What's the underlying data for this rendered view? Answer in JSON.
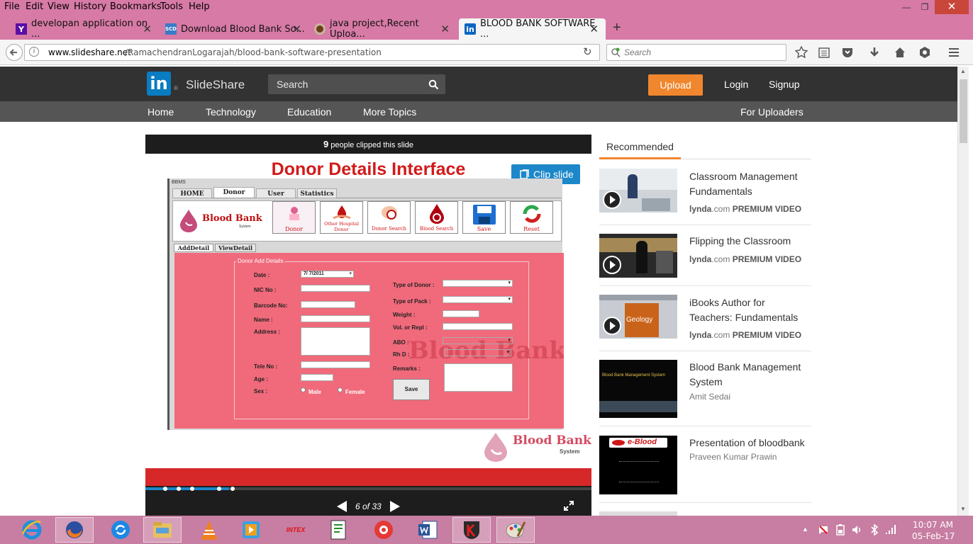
{
  "menu": [
    "File",
    "Edit",
    "View",
    "History",
    "Bookmarks",
    "Tools",
    "Help"
  ],
  "tabs": [
    {
      "title": "developan application on ...",
      "icon": "yahoo-icon"
    },
    {
      "title": "Download Blood Bank So...",
      "icon": "scd-icon"
    },
    {
      "title": "java project,Recent Uploa...",
      "icon": "java-icon"
    },
    {
      "title": "BLOOD BANK SOFTWARE ...",
      "icon": "linkedin-icon"
    }
  ],
  "url": {
    "host": "www.slideshare.net",
    "path": "/RamachendranLogarajah/blood-bank-software-presentation"
  },
  "browser_search_placeholder": "Search",
  "slideshare": {
    "brand": "SlideShare",
    "search_placeholder": "Search",
    "upload": "Upload",
    "login": "Login",
    "signup": "Signup",
    "nav": [
      "Home",
      "Technology",
      "Education",
      "More Topics"
    ],
    "for_uploaders": "For Uploaders"
  },
  "slide": {
    "clip_count": "9",
    "clip_text": "people clipped this slide",
    "clip_button": "Clip slide",
    "title": "Donor Details Interface",
    "counter": "6 of 33",
    "app": {
      "window_label": "BBMS",
      "tabs": [
        "HOME",
        "Donor",
        "User",
        "Statistics"
      ],
      "logo_text": "Blood Bank",
      "logo_sub": "System",
      "toolbar": [
        "Donor",
        "Other Hospital Donor",
        "Donor Search",
        "Blood Search",
        "Save",
        "Reset"
      ],
      "subtabs": [
        "AddDetail",
        "ViewDetail"
      ],
      "group_title": "Donor Add Details",
      "labels_left": [
        "Date :",
        "NIC No :",
        "Barcode No:",
        "Name :",
        "Address :",
        "Tele No :",
        "Age :",
        "Sex :"
      ],
      "date_value": "7/ 7/2011",
      "labels_right": [
        "Type of Donor :",
        "Type of Pack :",
        "Weight :",
        "Vol. or Repl :",
        "ABO :",
        "Rh D :",
        "Remarks :"
      ],
      "sex_options": [
        "Male",
        "Female"
      ],
      "save": "Save",
      "watermark": "Blood Bank"
    },
    "footer_logo": "Blood Bank",
    "footer_sub": "System"
  },
  "recommended": {
    "heading": "Recommended",
    "items": [
      {
        "title": "Classroom Management Fundamentals",
        "source": "lynda",
        "source_suffix": ".com",
        "badge": "PREMIUM VIDEO"
      },
      {
        "title": "Flipping the Classroom",
        "source": "lynda",
        "source_suffix": ".com",
        "badge": "PREMIUM VIDEO"
      },
      {
        "title": "iBooks Author for Teachers: Fundamentals",
        "source": "lynda",
        "source_suffix": ".com",
        "badge": "PREMIUM VIDEO",
        "thumb_text": "Geology"
      },
      {
        "title": "Blood Bank Management System",
        "author": "Amit Sedai",
        "thumb_text": "Blood Bank Management System"
      },
      {
        "title": "Presentation of bloodbank",
        "author": "Praveen Kumar Prawin",
        "thumb_text": "e-Blood"
      }
    ]
  },
  "taskbar": {
    "time": "10:07 AM",
    "date": "05-Feb-17",
    "apps": [
      "ie-icon",
      "firefox-icon",
      "sync-icon",
      "file-explorer-icon",
      "vlc-icon",
      "media-player-icon",
      "intex-icon",
      "notepad-icon",
      "photo-app-icon",
      "word-icon",
      "kaspersky-icon",
      "paint-icon"
    ],
    "intex_label": "INTEX"
  }
}
